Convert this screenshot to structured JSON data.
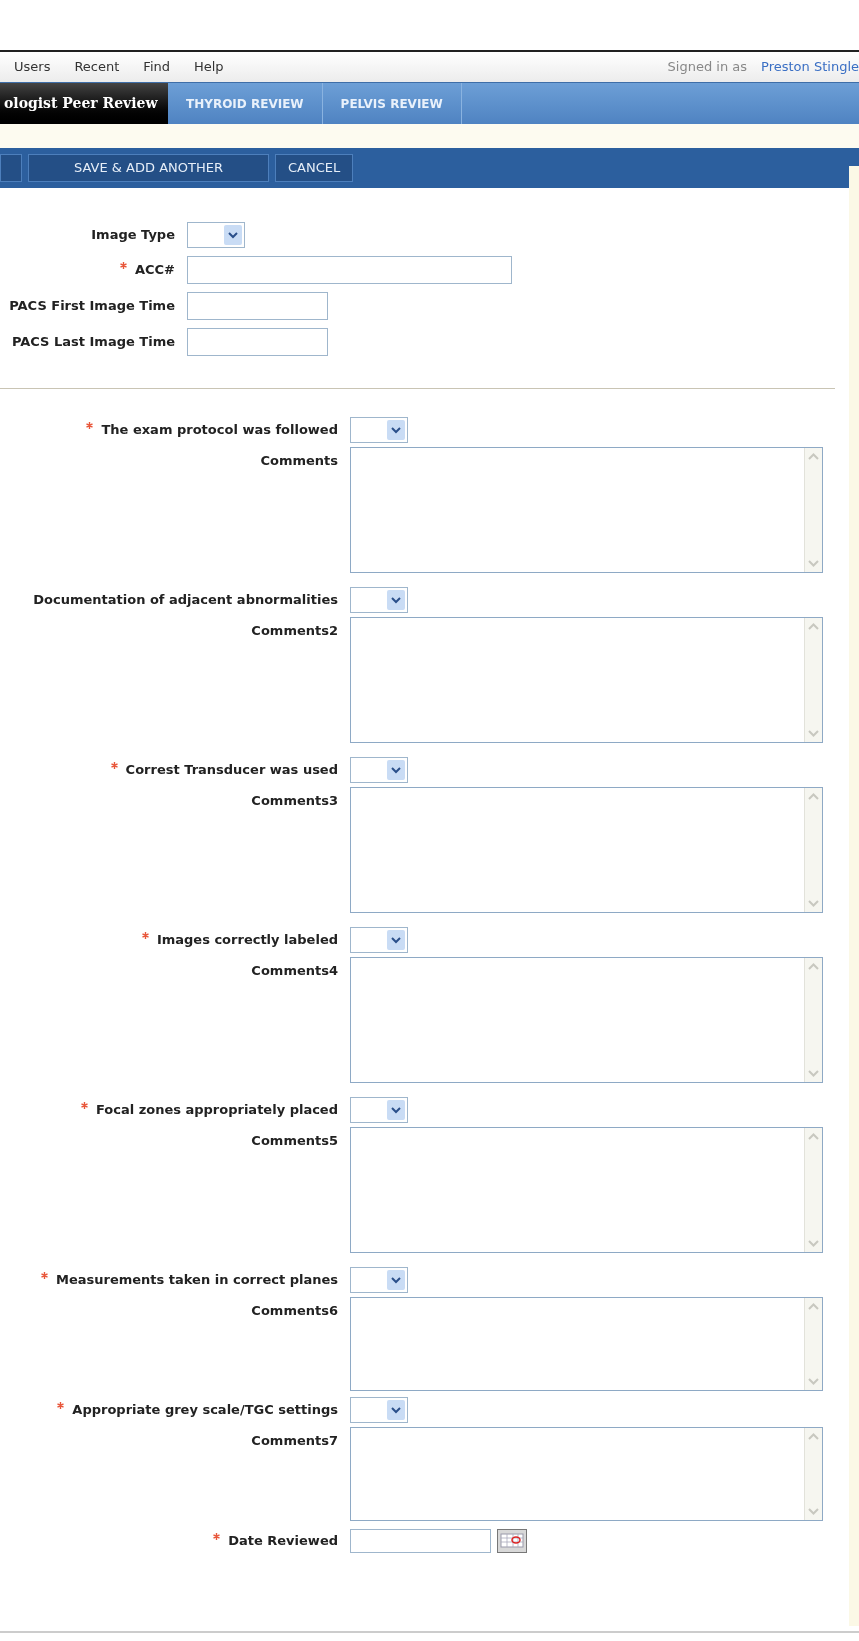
{
  "menu": [
    {
      "label": "Users"
    },
    {
      "label": "Recent"
    },
    {
      "label": "Find"
    },
    {
      "label": "Help"
    }
  ],
  "signed_in": {
    "label": "Signed in as",
    "user": "Preston Stingle"
  },
  "tabs": [
    {
      "label": "ologist Peer Review",
      "selected": true
    },
    {
      "label": "THYROID REVIEW",
      "selected": false
    },
    {
      "label": "PELVIS REVIEW",
      "selected": false
    }
  ],
  "toolbar": [
    "SAVE & ADD ANOTHER",
    "CANCEL"
  ],
  "header_fields": [
    {
      "label": "Image Type",
      "required": false,
      "kind": "select"
    },
    {
      "label": "ACC#",
      "required": true,
      "kind": "wide"
    },
    {
      "label": "PACS First Image Time",
      "required": false,
      "kind": "short"
    },
    {
      "label": "PACS Last Image Time",
      "required": false,
      "kind": "short"
    }
  ],
  "questions": [
    {
      "label": "The exam protocol was followed",
      "required": true,
      "comments_label": "Comments"
    },
    {
      "label": "Documentation of adjacent abnormalities",
      "required": false,
      "comments_label": "Comments2"
    },
    {
      "label": "Correst Transducer was used",
      "required": true,
      "comments_label": "Comments3"
    },
    {
      "label": "Images correctly labeled",
      "required": true,
      "comments_label": "Comments4"
    },
    {
      "label": "Focal zones appropriately placed",
      "required": true,
      "comments_label": "Comments5"
    },
    {
      "label": "Measurements taken in correct planes",
      "required": true,
      "comments_label": "Comments6"
    },
    {
      "label": "Appropriate grey scale/TGC settings",
      "required": true,
      "comments_label": "Comments7"
    }
  ],
  "date_field": {
    "label": "Date Reviewed",
    "required": true
  }
}
